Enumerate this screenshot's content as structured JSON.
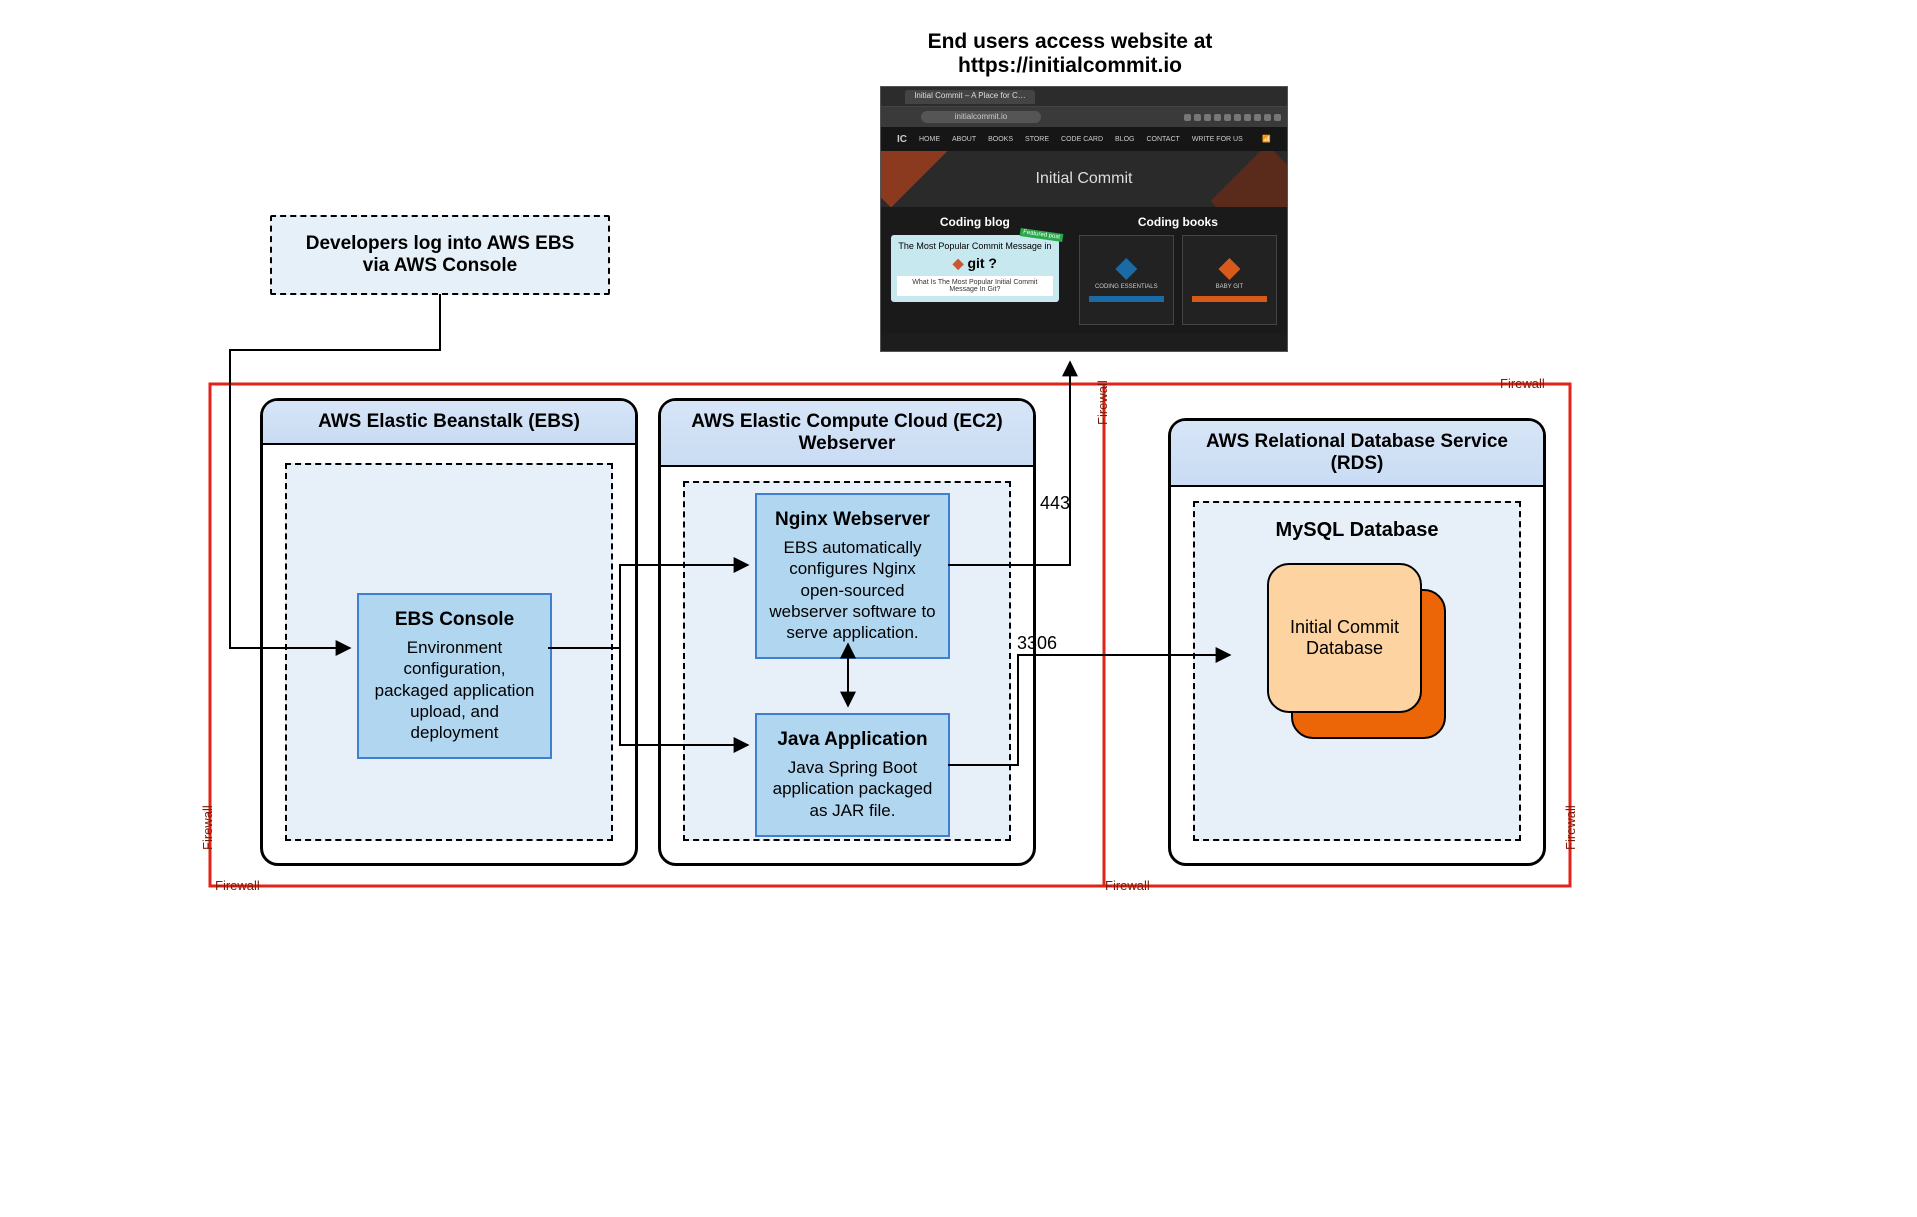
{
  "caption": {
    "line1": "End users access website at",
    "line2": "https://initialcommit.io"
  },
  "dev_note": {
    "line1": "Developers log into AWS EBS",
    "line2": "via AWS Console"
  },
  "panels": {
    "ebs": {
      "title": "AWS Elastic Beanstalk (EBS)",
      "console": {
        "title": "EBS Console",
        "desc": "Environment configuration, packaged application upload, and deployment"
      }
    },
    "ec2": {
      "title": "AWS Elastic Compute Cloud (EC2) Webserver",
      "nginx": {
        "title": "Nginx Webserver",
        "desc": "EBS automatically configures Nginx open-sourced webserver software to serve application."
      },
      "java": {
        "title": "Java Application",
        "desc": "Java Spring Boot application packaged as JAR file."
      }
    },
    "rds": {
      "title": "AWS Relational Database Service (RDS)",
      "db_label": "MySQL Database",
      "db_name": "Initial Commit Database"
    }
  },
  "ports": {
    "https": "443",
    "mysql": "3306"
  },
  "firewall_label": "Firewall",
  "browser": {
    "tab_title": "Initial Commit – A Place for C…",
    "url": "initialcommit.io",
    "nav": [
      "HOME",
      "ABOUT",
      "BOOKS",
      "STORE",
      "CODE CARD",
      "BLOG",
      "CONTACT",
      "WRITE FOR US"
    ],
    "hero": "Initial Commit",
    "blog": {
      "heading": "Coding blog",
      "featured_badge": "Featured post",
      "card_title": "The Most Popular Commit Message in",
      "card_git": "git ?",
      "card_sub": "What Is The Most Popular Initial Commit Message In Git?"
    },
    "books": {
      "heading": "Coding books",
      "book1": "CODING ESSENTIALS",
      "book2": "BABY GIT"
    }
  }
}
